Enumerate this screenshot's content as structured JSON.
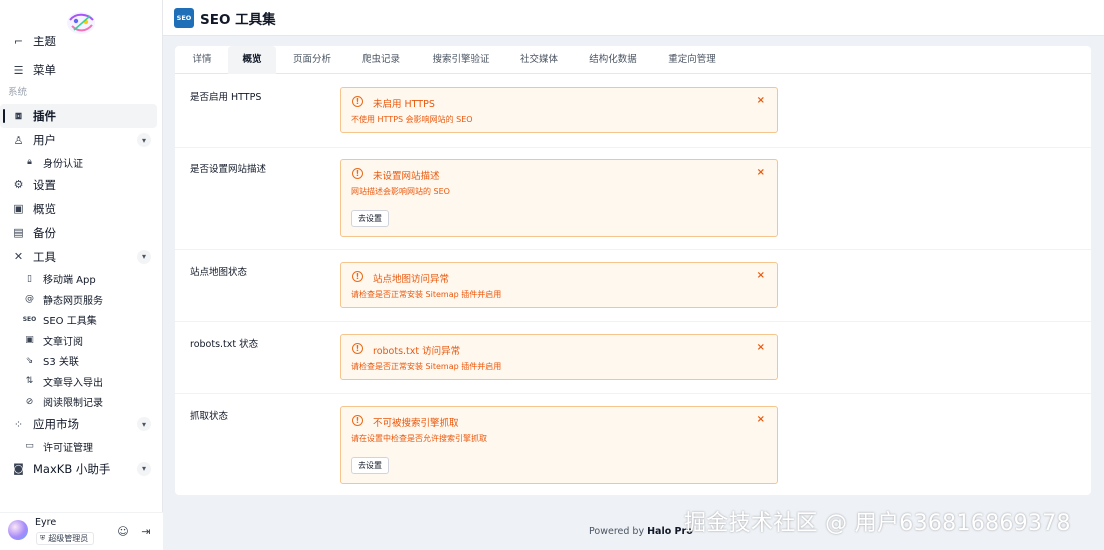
{
  "sidebar": {
    "partial_item": "主题",
    "menu": "菜单",
    "section_system": "系统",
    "plugins": "插件",
    "users": "用户",
    "auth": "身份认证",
    "settings": "设置",
    "overview": "概览",
    "backup": "备份",
    "tools": "工具",
    "tool_items": [
      "移动端 App",
      "静态网页服务",
      "SEO 工具集",
      "文章订阅",
      "S3 关联",
      "文章导入导出",
      "阅读限制记录"
    ],
    "market": "应用市场",
    "license": "许可证管理",
    "maxkb": "MaxKB 小助手"
  },
  "profile": {
    "name": "Eyre",
    "role": "超级管理员"
  },
  "header": {
    "logo_text": "SEO",
    "title": "SEO 工具集"
  },
  "tabs": [
    "详情",
    "概览",
    "页面分析",
    "爬虫记录",
    "搜索引擎验证",
    "社交媒体",
    "结构化数据",
    "重定向管理"
  ],
  "checks": [
    {
      "label": "是否启用 HTTPS",
      "title": "未启用 HTTPS",
      "desc": "不使用 HTTPS 会影响网站的 SEO"
    },
    {
      "label": "是否设置网站描述",
      "title": "未设置网站描述",
      "desc": "网站描述会影响网站的 SEO",
      "button": "去设置"
    },
    {
      "label": "站点地图状态",
      "title": "站点地图访问异常",
      "desc": "请检查是否正常安装 Sitemap 插件并启用"
    },
    {
      "label": "robots.txt 状态",
      "title": "robots.txt 访问异常",
      "desc": "请检查是否正常安装 Sitemap 插件并启用"
    },
    {
      "label": "抓取状态",
      "title": "不可被搜索引擎抓取",
      "desc": "请在设置中检查是否允许搜索引擎抓取",
      "button": "去设置"
    }
  ],
  "footer": {
    "prefix": "Powered by",
    "brand": "Halo Pro"
  },
  "watermark": "掘金技术社区 @ 用户636816869378",
  "colors": {
    "warning": "#ea580c",
    "alert_bg": "#fff8ef",
    "alert_border": "#f6c48d",
    "seo_logo": "#1e6fb8"
  }
}
